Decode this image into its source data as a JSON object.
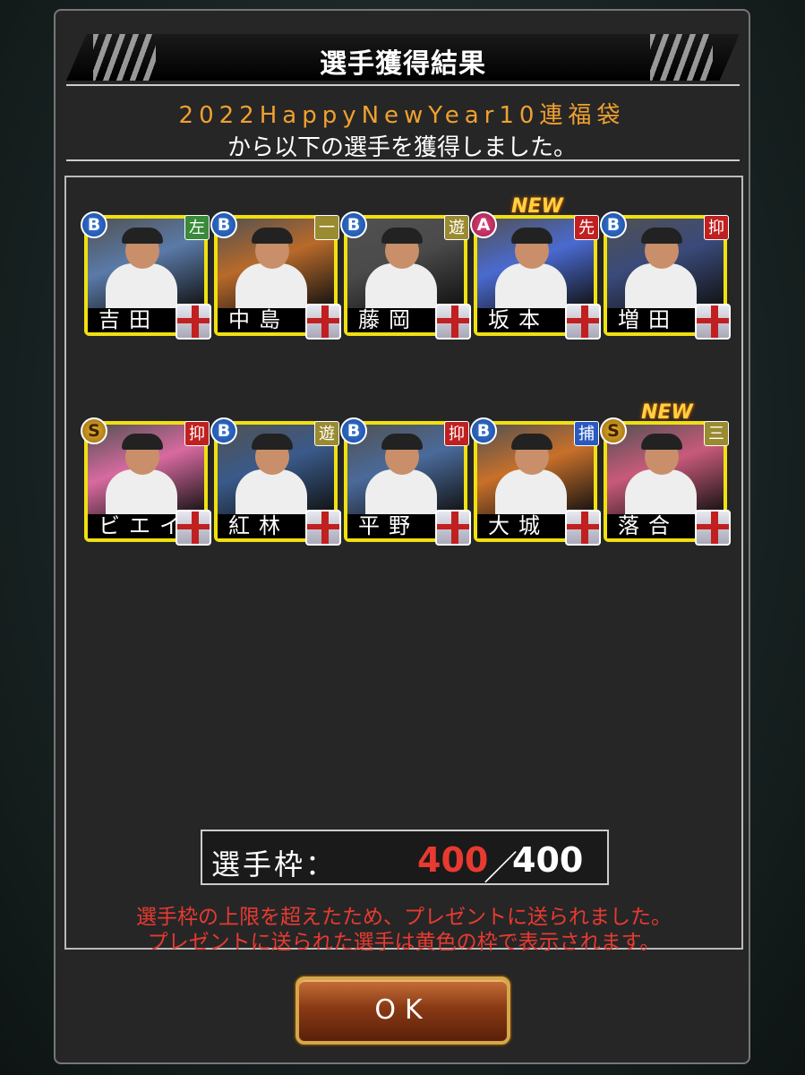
{
  "dialog": {
    "title": "選手獲得結果",
    "event_name": "2022HappyNewYear10連福袋",
    "message": "から以下の選手を獲得しました。"
  },
  "players": [
    {
      "name": "吉田",
      "rank": "B",
      "position": "左",
      "position_color": "#3a8a3a",
      "photo_bg": "#5a7aa8",
      "is_new": false
    },
    {
      "name": "中島",
      "rank": "B",
      "position": "一",
      "position_color": "#9a8a30",
      "photo_bg": "#b86a2a",
      "is_new": false
    },
    {
      "name": "藤岡",
      "rank": "B",
      "position": "遊",
      "position_color": "#9a8a30",
      "photo_bg": "#4a4a4a",
      "is_new": false
    },
    {
      "name": "坂本",
      "rank": "A",
      "position": "先",
      "position_color": "#c02020",
      "photo_bg": "#4a6ad0",
      "is_new": true
    },
    {
      "name": "増田",
      "rank": "B",
      "position": "抑",
      "position_color": "#c02020",
      "photo_bg": "#3a4a7a",
      "is_new": false
    },
    {
      "name": "ビエイラ",
      "rank": "S",
      "position": "抑",
      "position_color": "#c02020",
      "photo_bg": "#d86aa0",
      "is_new": false
    },
    {
      "name": "紅林",
      "rank": "B",
      "position": "遊",
      "position_color": "#9a8a30",
      "photo_bg": "#3a5a8a",
      "is_new": false
    },
    {
      "name": "平野",
      "rank": "B",
      "position": "抑",
      "position_color": "#c02020",
      "photo_bg": "#4a6a9a",
      "is_new": false
    },
    {
      "name": "大城",
      "rank": "B",
      "position": "捕",
      "position_color": "#2a5ac0",
      "photo_bg": "#c8702a",
      "is_new": false
    },
    {
      "name": "落合",
      "rank": "S",
      "position": "三",
      "position_color": "#9a8a30",
      "photo_bg": "#c85a7a",
      "is_new": true
    }
  ],
  "new_label": "NEW",
  "slots": {
    "label": "選手枠：",
    "current": "400",
    "separator": "／",
    "max": "400"
  },
  "warnings": {
    "line1": "選手枠の上限を超えたため、プレゼントに送られました。",
    "line2": "プレゼントに送られた選手は黄色の枠で表示されます。"
  },
  "ok_label": "OK",
  "colors": {
    "highlight_frame": "#f0e010",
    "warning_text": "#e83a30",
    "event_name": "#f0a030"
  }
}
